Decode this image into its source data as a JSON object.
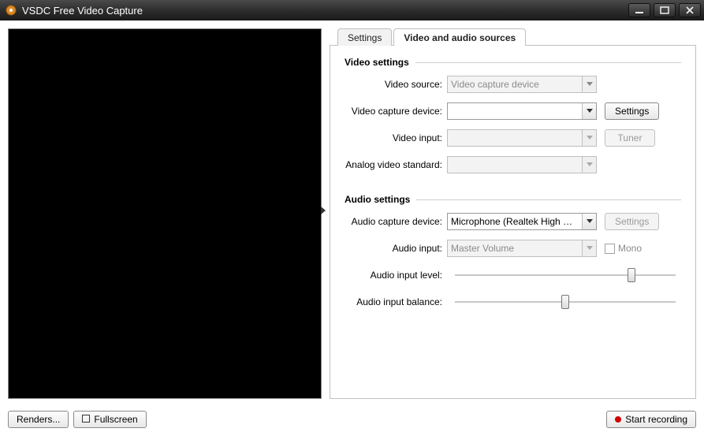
{
  "window": {
    "title": "VSDC Free Video Capture"
  },
  "tabs": {
    "settings": "Settings",
    "sources": "Video and audio sources"
  },
  "video_settings": {
    "group_title": "Video settings",
    "video_source_label": "Video source:",
    "video_source_value": "Video capture device",
    "capture_device_label": "Video capture device:",
    "capture_device_value": "",
    "settings_button": "Settings",
    "video_input_label": "Video input:",
    "video_input_value": "",
    "tuner_button": "Tuner",
    "analog_label": "Analog video standard:",
    "analog_value": ""
  },
  "audio_settings": {
    "group_title": "Audio settings",
    "capture_device_label": "Audio capture device:",
    "capture_device_value": "Microphone (Realtek High Definition Aud",
    "settings_button": "Settings",
    "audio_input_label": "Audio input:",
    "audio_input_value": "Master Volume",
    "mono_label": "Mono",
    "input_level_label": "Audio input level:",
    "input_level_percent": 80,
    "input_balance_label": "Audio input balance:",
    "input_balance_percent": 50
  },
  "bottom": {
    "renders": "Renders...",
    "fullscreen": "Fullscreen",
    "start_recording": "Start recording"
  }
}
